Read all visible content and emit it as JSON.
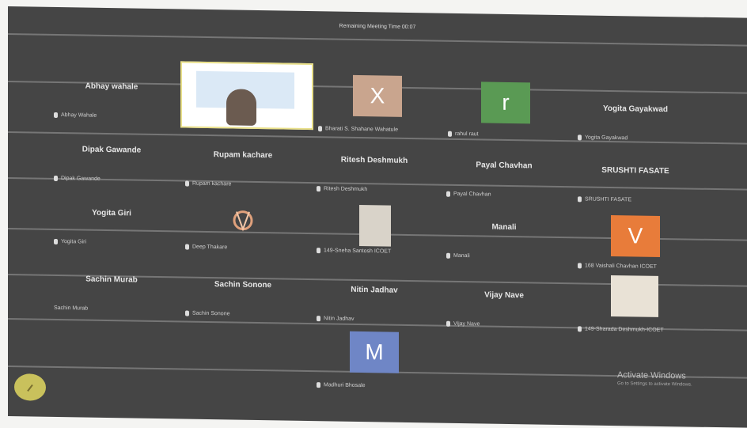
{
  "meeting": {
    "remaining_time": "Remaining Meeting Time 00:07"
  },
  "presenter": {
    "label": ""
  },
  "participants": [
    {
      "display": "Abhay wahale",
      "label": "Abhay Wahale"
    },
    {
      "display": "X",
      "label": "Bharati S. Shahane Wahatule",
      "avatar_color": "#c9a58e"
    },
    {
      "display": "r",
      "label": "rahul raut",
      "avatar_color": "#5a9a54"
    },
    {
      "display": "Yogita Gayakwad",
      "label": "Yogita Gayakwad"
    },
    {
      "display": "Dipak Gawande",
      "label": "Dipak Gawande"
    },
    {
      "display": "Rupam kachare",
      "label": "Rupam kachare"
    },
    {
      "display": "Ritesh Deshmukh",
      "label": "Ritesh Deshmukh"
    },
    {
      "display": "Payal Chavhan",
      "label": "Payal Chavhan"
    },
    {
      "display": "SRUSHTI FASATE",
      "label": "SRUSHTI FASATE"
    },
    {
      "display": "Yogita Giri",
      "label": "Yogita Giri"
    },
    {
      "display": "",
      "label": "Deep Thakare"
    },
    {
      "display": "",
      "label": "149-Sneha Santosh ICOET"
    },
    {
      "display": "Manali",
      "label": "Manali"
    },
    {
      "display": "V",
      "label": "168 Vaishali Chavhan ICOET",
      "avatar_color": "#e87c3a"
    },
    {
      "display": "Sachin Murab",
      "label": "Sachin Murab"
    },
    {
      "display": "Sachin Sonone",
      "label": "Sachin Sonone"
    },
    {
      "display": "Nitin Jadhav",
      "label": "Nitin Jadhav"
    },
    {
      "display": "Vijay Nave",
      "label": "Vijay Nave"
    },
    {
      "display": "",
      "label": "149-Sharada Deshmukh-ICOET"
    },
    {
      "display": "M",
      "label": "Madhuri Bhosale",
      "avatar_color": "#6f86c6"
    }
  ],
  "watermark": {
    "title": "Activate Windows",
    "subtitle": "Go to Settings to activate Windows."
  }
}
